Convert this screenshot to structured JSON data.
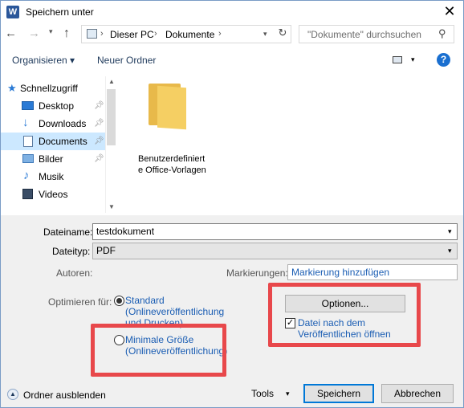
{
  "window": {
    "app_icon": "W",
    "title": "Speichern unter",
    "close_glyph": "✕"
  },
  "address": {
    "crumbs": [
      "Dieser PC",
      "Dokumente"
    ],
    "search_placeholder": "\"Dokumente\" durchsuchen"
  },
  "toolbar": {
    "organize": "Organisieren ▾",
    "new_folder": "Neuer Ordner"
  },
  "nav": {
    "items": [
      {
        "label": "Schnellzugriff",
        "icon": "star-icon",
        "pinned": false,
        "selected": false
      },
      {
        "label": "Desktop",
        "icon": "desktop-icon",
        "pinned": true,
        "selected": false
      },
      {
        "label": "Downloads",
        "icon": "download-icon",
        "pinned": true,
        "selected": false
      },
      {
        "label": "Documents",
        "icon": "document-icon",
        "pinned": true,
        "selected": true
      },
      {
        "label": "Bilder",
        "icon": "pictures-icon",
        "pinned": true,
        "selected": false
      },
      {
        "label": "Musik",
        "icon": "music-icon",
        "pinned": false,
        "selected": false
      },
      {
        "label": "Videos",
        "icon": "videos-icon",
        "pinned": false,
        "selected": false
      }
    ]
  },
  "files": {
    "folder_label": "Benutzerdefiniert e Office-Vorlagen"
  },
  "form": {
    "filename_label": "Dateiname:",
    "filename_value": "testdokument",
    "filetype_label": "Dateityp:",
    "filetype_value": "PDF",
    "authors_label": "Autoren:",
    "tags_label": "Markierungen:",
    "tags_placeholder": "Markierung hinzufügen",
    "optimize_label": "Optimieren für:",
    "radio_standard": "Standard (Onlineveröffentlichung und Drucken)",
    "radio_min": "Minimale Größe (Onlineveröffentlichung)",
    "options_button": "Optionen...",
    "open_after_publish": "Datei nach dem Veröffentlichen öffnen"
  },
  "footer": {
    "hide_folders": "Ordner ausblenden",
    "tools": "Tools",
    "save": "Speichern",
    "cancel": "Abbrechen"
  },
  "colors": {
    "highlight_box": "#e8484b",
    "selection": "#cce8ff",
    "link_text": "#1a5db3",
    "default_button_border": "#0078d7"
  }
}
